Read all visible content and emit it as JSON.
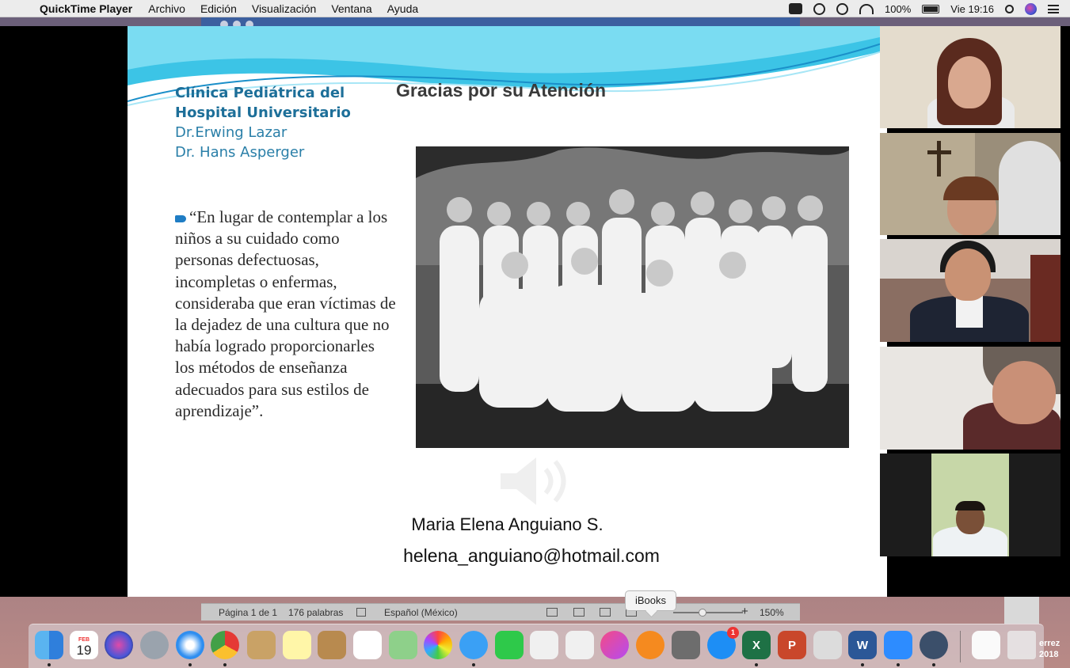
{
  "menubar": {
    "app_name": "QuickTime Player",
    "menus": [
      "Archivo",
      "Edición",
      "Visualización",
      "Ventana",
      "Ayuda"
    ],
    "battery": "100%",
    "clock": "Vie 19:16"
  },
  "slide": {
    "heading_line1": "Clínica Pediátrica del",
    "heading_line2": "Hospital Universitario",
    "heading_line3": "Dr.Erwing Lazar",
    "heading_line4": "Dr. Hans Asperger",
    "title": "Gracias por su Atención",
    "quote": "“En lugar de contemplar a los niños a su cuidado como personas defectuosas, incompletas o enfermas, consideraba que eran víctimas de la dejadez de una cultura que no había logrado proporcionarles los métodos de enseñanza adecuados para sus estilos de aprendizaje”.",
    "author": "Maria Elena Anguiano S.",
    "email": "helena_anguiano@hotmail.com"
  },
  "word_status": {
    "page": "Página 1 de 1",
    "words": "176 palabras",
    "language": "Español (México)",
    "zoom": "150%"
  },
  "tooltip": "iBooks",
  "dock": {
    "calendar_month": "FEB",
    "calendar_day": "19",
    "appstore_badge": "1",
    "desktop_text_line1": "errez",
    "desktop_text_line2": "2018"
  }
}
